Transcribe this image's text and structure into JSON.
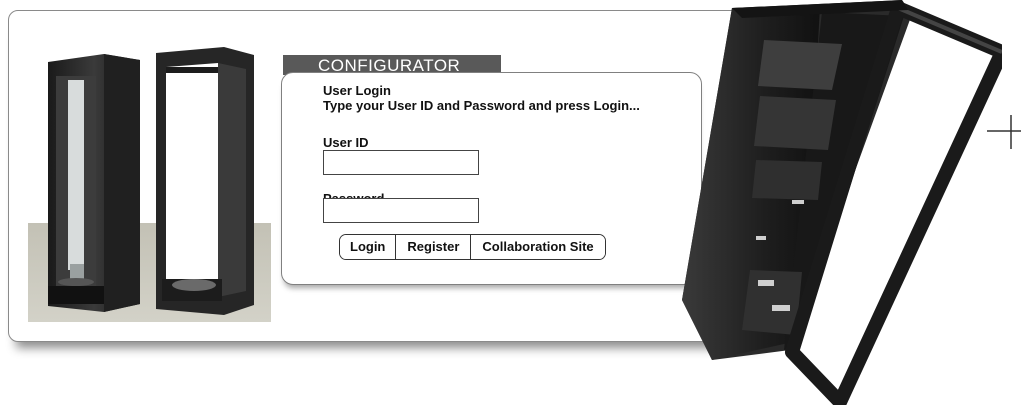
{
  "configurator": {
    "tab_label": "CONFIGURATOR",
    "login_title": "User Login",
    "login_instructions": "Type your User ID and Password and press Login...",
    "user_id_label": "User ID",
    "user_id_value": "",
    "password_label": "Password",
    "password_value": "",
    "buttons": {
      "login": "Login",
      "register": "Register",
      "collaboration": "Collaboration Site"
    }
  },
  "colors": {
    "tab_background": "#595959",
    "frame_border": "#8a8a8a",
    "rack_body": "#2b2b2b",
    "floor": "#c3c1b5"
  },
  "icons": {
    "crosshair": "crosshair-plus-icon"
  }
}
